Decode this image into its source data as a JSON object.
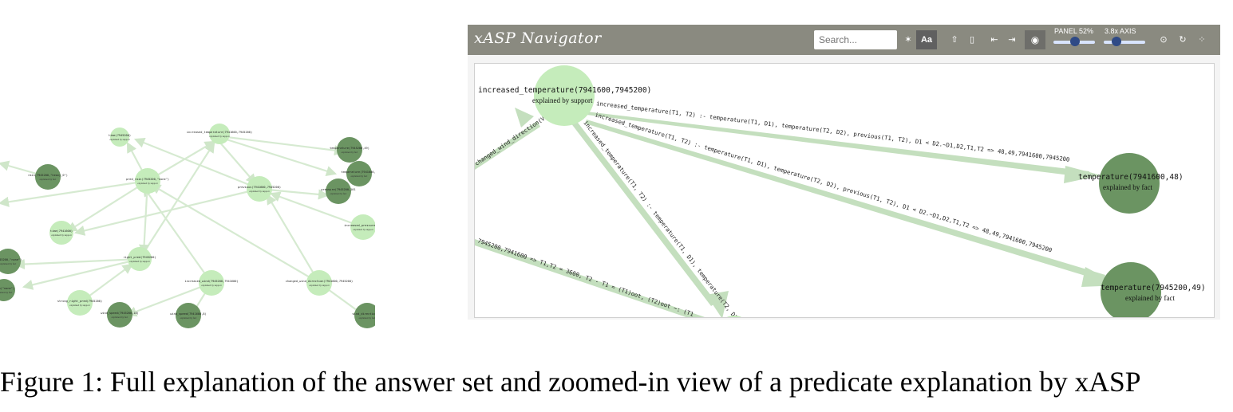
{
  "navigator": {
    "title": "xASP Navigator",
    "search_placeholder": "Search...",
    "aa_label": "Aa",
    "panel_label": "PANEL 52%",
    "panel_value": 0.52,
    "axis_label": "3.8x AXIS",
    "axis_value": 0.3,
    "icons": [
      "magic-icon",
      "share-icon",
      "bookmark-icon",
      "back-icon",
      "forward-icon",
      "eye-icon",
      "target-icon",
      "refresh-icon",
      "grid-icon"
    ],
    "nodes": {
      "increased": {
        "label": "increased_temperature(7941600,7945200)",
        "sub": "explained by support"
      },
      "temp48": {
        "label": "temperature(7941600,48)",
        "sub": "explained by fact"
      },
      "temp49": {
        "label": "temperature(7945200,49)",
        "sub": "explained by fact"
      }
    },
    "edges": {
      "e1": "increased_temperature(T1, T2) :- temperature(T1, D1),  temperature(T2, D2), previous(T1, T2), D1 < D2.~D1,D2,T1,T2 => 48,49,7941600,7945200",
      "e2": "increased_temperature(T1, T2) :- temperature(T1, D1),  temperature(T2, D2), previous(T1, T2), D1 < D2.~D1,D2,T1,T2 => 48,49,7941600,7945200",
      "e3": "increased_temperature(T1, T2) :- temperature(T1, D1),  temperature(T2, D2),",
      "e4": "7945200,7941600 => T1,T2 = 3600, T2 - T1 = (T1)oot, (T2)oot ~: (T1",
      "e5": "changed_wind_direction(Vi"
    }
  },
  "left_graph": {
    "nodes": [
      {
        "id": "time1",
        "label": "time(7945200)",
        "sub": "explained by support",
        "shade": "light"
      },
      {
        "id": "inc",
        "label": "increased_temperature(7941600,7945200)",
        "sub": "explained by support",
        "shade": "light"
      },
      {
        "id": "temp_a",
        "label": "temperature(7945200,49)",
        "sub": "explained by fact",
        "shade": "dark"
      },
      {
        "id": "temp_b",
        "label": "temperature(7941600,4",
        "sub": "explained by fact",
        "shade": "dark"
      },
      {
        "id": "pressure",
        "label": "pressure(7945200,101",
        "sub": "explained by fact",
        "shade": "dark"
      },
      {
        "id": "rain",
        "label": "rain(7945200,\"heavy_0\")",
        "sub": "explained by fact",
        "shade": "dark"
      },
      {
        "id": "pred",
        "label": "pred_rain(7945200,\"none\")",
        "sub": "explained by support",
        "shade": "light"
      },
      {
        "id": "previous",
        "label": "previous(7941600,7945200)",
        "sub": "explained by support",
        "shade": "light"
      },
      {
        "id": "time2",
        "label": "time(7941600)",
        "sub": "explained by support",
        "shade": "light"
      },
      {
        "id": "incp",
        "label": "increased_pressure(794",
        "sub": "explained by support",
        "shade": "light"
      },
      {
        "id": "rp1",
        "label": "(7945200,\"none\")",
        "sub": "explained by fact",
        "shade": "dark"
      },
      {
        "id": "rp2",
        "label": "rain(\"none\")",
        "sub": "explained by fact",
        "shade": "dark"
      },
      {
        "id": "right",
        "label": "right_pred(7945200)",
        "sub": "explained by support",
        "shade": "light"
      },
      {
        "id": "wind",
        "label": "increased_wind(7945200,7941600)",
        "sub": "explained by support",
        "shade": "light"
      },
      {
        "id": "chw",
        "label": "changed_wind_direction(7941600,7945200)",
        "sub": "explained by support",
        "shade": "light"
      },
      {
        "id": "strong",
        "label": "strong_right_pred(7945200)",
        "sub": "explained by support",
        "shade": "light"
      },
      {
        "id": "ws1",
        "label": "wind_speed(7945200,18)",
        "sub": "explained by fact",
        "shade": "dark"
      },
      {
        "id": "ws2",
        "label": "wind_speed(7941600,8)",
        "sub": "explained by fact",
        "shade": "dark"
      },
      {
        "id": "wd",
        "label": "wind_direction(79",
        "sub": "explained by fact",
        "shade": "dark"
      }
    ]
  },
  "colors": {
    "light_node": "#c5ecbb",
    "dark_node": "#6b9462",
    "edge": "#c4dfbe",
    "toolbar": "#8a8a80"
  },
  "caption": "Figure 1: Full explanation of the answer set and zoomed-in view of a predicate explanation by xASP"
}
